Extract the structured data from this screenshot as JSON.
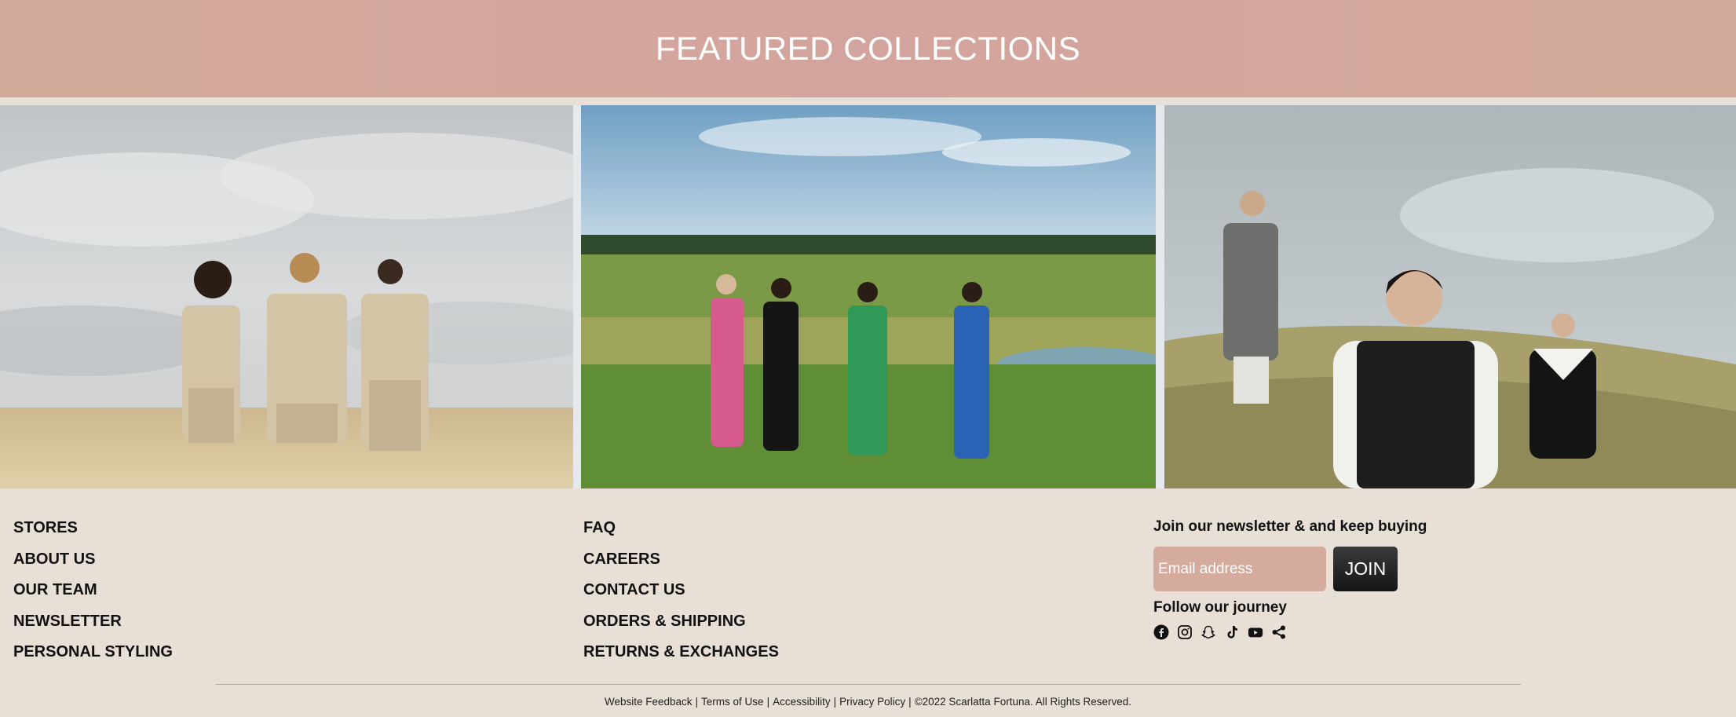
{
  "hero": {
    "title": "FEATURED COLLECTIONS"
  },
  "footer": {
    "col1": [
      "STORES",
      "ABOUT US",
      "OUR TEAM",
      "NEWSLETTER",
      "PERSONAL STYLING"
    ],
    "col2": [
      "FAQ",
      "CAREERS",
      "CONTACT US",
      "ORDERS & SHIPPING",
      "RETURNS & EXCHANGES"
    ],
    "newsletter": {
      "title": "Join our newsletter & and keep buying",
      "placeholder": "Email address",
      "button": "JOIN"
    },
    "follow": "Follow our journey",
    "socials": [
      "facebook-icon",
      "instagram-icon",
      "snapchat-icon",
      "tiktok-icon",
      "youtube-icon",
      "share-icon"
    ]
  },
  "legal": {
    "links": [
      "Website Feedback",
      "Terms of Use",
      "Accessibility",
      "Privacy Policy"
    ],
    "copyright": "©2022 Scarlatta Fortuna. All Rights Reserved."
  }
}
